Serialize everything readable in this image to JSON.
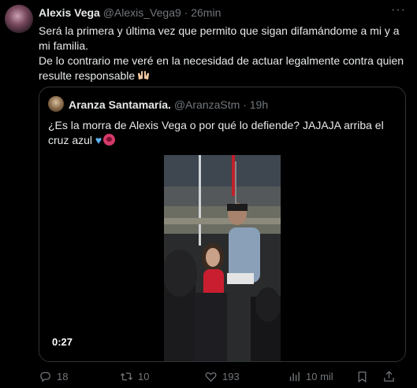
{
  "tweet": {
    "display_name": "Alexis Vega",
    "handle": "@Alexis_Vega9",
    "separator": "·",
    "time": "26min",
    "line1": "Será la primera y última vez que permito que sigan difamándome a mi y a mi familia.",
    "line2": "De lo contrario me veré en la necesidad de actuar legalmente contra quien resulte responsable"
  },
  "quote": {
    "display_name": "Aranza Santamaría.",
    "handle": "@AranzaStm",
    "separator": "·",
    "time": "19h",
    "text": "¿Es la morra de Alexis Vega o por qué lo defiende? JAJAJA arriba el cruz azul",
    "video_duration": "0:27"
  },
  "actions": {
    "replies": "18",
    "reposts": "10",
    "likes": "193",
    "views": "10 mil"
  },
  "icons": [
    "more-icon",
    "heart-emoji-icon",
    "angry-face-emoji-icon",
    "raised-hands-emoji-icon",
    "reply-icon",
    "repost-icon",
    "like-icon",
    "views-icon",
    "bookmark-icon",
    "share-icon"
  ],
  "colors": {
    "background": "#000000",
    "text": "#e7e9ea",
    "muted": "#71767b",
    "border": "#2f3336"
  }
}
